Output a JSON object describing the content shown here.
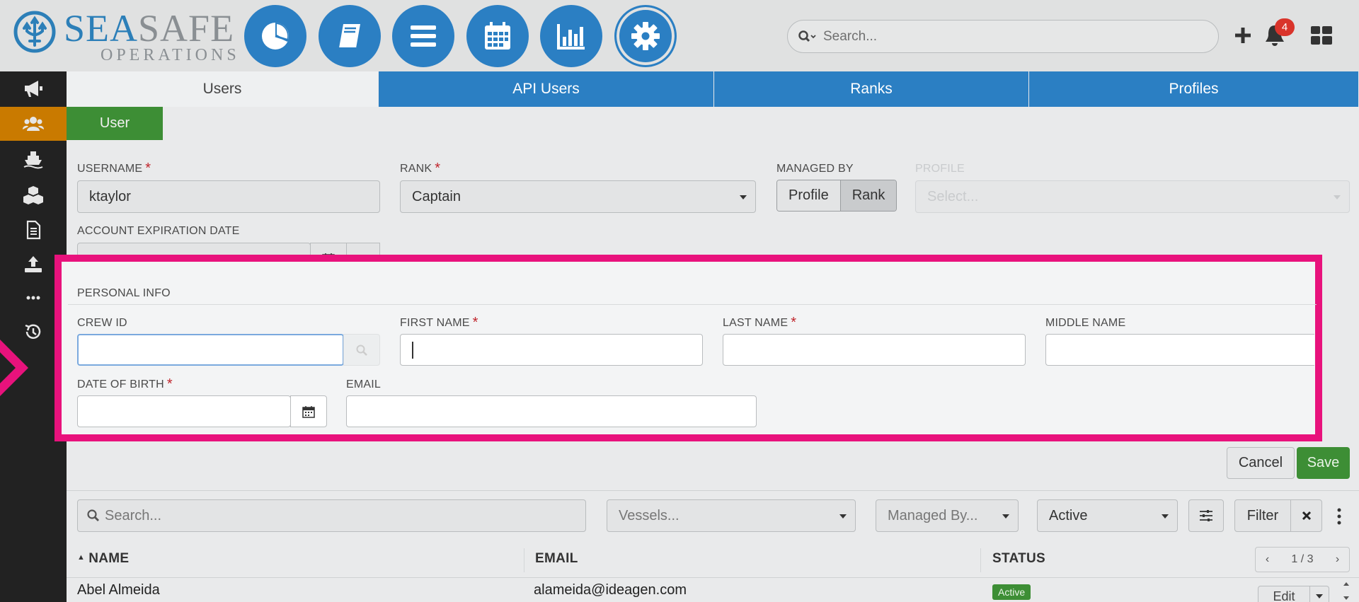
{
  "brand": {
    "name_part1": "SEA",
    "name_part2": "SAFE",
    "subtitle": "OPERATIONS"
  },
  "colors": {
    "primary": "#2b7fc3",
    "success": "#3d8e35",
    "warning": "#c97a00",
    "danger": "#d9342b",
    "highlight": "#e8127c"
  },
  "nav": [
    {
      "name": "dashboard",
      "icon": "pie-chart-icon"
    },
    {
      "name": "book",
      "icon": "book-icon"
    },
    {
      "name": "menu",
      "icon": "bars-icon"
    },
    {
      "name": "calendar",
      "icon": "calendar-icon"
    },
    {
      "name": "reports",
      "icon": "bar-chart-icon"
    },
    {
      "name": "settings",
      "icon": "gear-icon",
      "active": true
    }
  ],
  "header": {
    "search_placeholder": "Search...",
    "notifications_count": "4"
  },
  "sidebar": [
    {
      "icon": "megaphone-icon"
    },
    {
      "icon": "users-icon",
      "active": true
    },
    {
      "icon": "ship-icon"
    },
    {
      "icon": "cubes-icon"
    },
    {
      "icon": "document-icon"
    },
    {
      "icon": "upload-icon"
    },
    {
      "icon": "ellipsis-icon"
    },
    {
      "icon": "history-icon"
    }
  ],
  "tabs": [
    {
      "label": "Users",
      "active": true
    },
    {
      "label": "API Users"
    },
    {
      "label": "Ranks"
    },
    {
      "label": "Profiles"
    }
  ],
  "subtab": {
    "label": "User"
  },
  "form": {
    "username_label": "USERNAME",
    "username_value": "ktaylor",
    "rank_label": "RANK",
    "rank_value": "Captain",
    "managed_by_label": "MANAGED BY",
    "managed_by_options": [
      "Profile",
      "Rank"
    ],
    "managed_by_selected": "Rank",
    "profile_label": "PROFILE",
    "profile_placeholder": "Select...",
    "account_expiration_label": "ACCOUNT EXPIRATION DATE",
    "personal_info_label": "PERSONAL INFO",
    "crew_id_label": "CREW ID",
    "crew_id_value": "",
    "first_name_label": "FIRST NAME",
    "first_name_value": "",
    "last_name_label": "LAST NAME",
    "last_name_value": "",
    "middle_name_label": "MIDDLE NAME",
    "middle_name_value": "",
    "dob_label": "DATE OF BIRTH",
    "dob_value": "",
    "email_label": "EMAIL",
    "email_value": "",
    "required_marker": "*"
  },
  "actions": {
    "cancel": "Cancel",
    "save": "Save"
  },
  "filters": {
    "search_placeholder": "Search...",
    "vessels_placeholder": "Vessels...",
    "managed_by_placeholder": "Managed By...",
    "status_value": "Active",
    "filter_button": "Filter"
  },
  "table": {
    "columns": [
      "NAME",
      "EMAIL",
      "STATUS"
    ],
    "pagination": "1 / 3",
    "rows": [
      {
        "name": "Abel Almeida",
        "email": "alameida@ideagen.com",
        "status": "Active",
        "action": "Edit"
      }
    ]
  }
}
